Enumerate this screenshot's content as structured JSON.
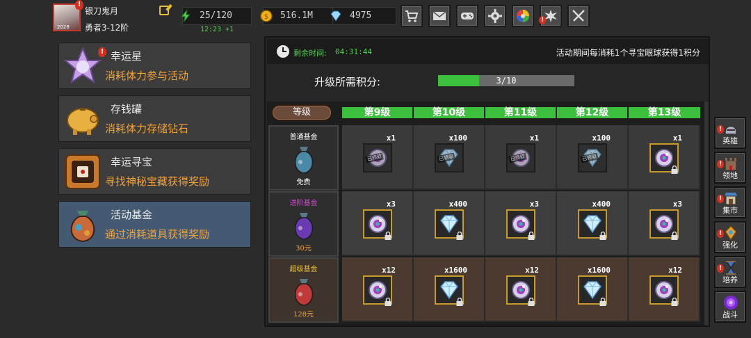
{
  "player": {
    "name": "银刀鬼月",
    "rank": "勇者3-12阶",
    "avatar_year": "2028"
  },
  "resources": {
    "stamina": "25/120",
    "stamina_timer": "12:23 +1",
    "gold": "516.1M",
    "diamonds": "4975"
  },
  "toolbar": [
    {
      "name": "shop-cart-icon",
      "alert": false
    },
    {
      "name": "mail-icon",
      "alert": false
    },
    {
      "name": "gamepad-icon",
      "alert": false
    },
    {
      "name": "settings-gear-icon",
      "alert": false
    },
    {
      "name": "color-wheel-icon",
      "alert": false
    },
    {
      "name": "burst-icon",
      "alert": true
    },
    {
      "name": "crossed-swords-icon",
      "alert": false
    }
  ],
  "events": [
    {
      "title": "幸运星",
      "desc": "消耗体力参与活动",
      "icon": "lucky-star-icon",
      "alert": true
    },
    {
      "title": "存钱罐",
      "desc": "消耗体力存储钻石",
      "icon": "piggy-bank-icon",
      "alert": false
    },
    {
      "title": "幸运寻宝",
      "desc": "寻找神秘宝藏获得奖励",
      "icon": "treasure-chest-icon",
      "alert": false
    },
    {
      "title": "活动基金",
      "desc": "通过消耗道具获得奖励",
      "icon": "fund-bag-icon",
      "alert": false
    }
  ],
  "panel": {
    "remaining_label": "剩余时间:",
    "remaining_time": "04:31:44",
    "rule": "活动期间每消耗1个寻宝眼球获得1积分",
    "upgrade_label": "升级所需积分:",
    "progress_text": "3/10",
    "progress_fraction": 0.3,
    "level_button": "等级",
    "levels": [
      "第9级",
      "第10级",
      "第11级",
      "第12级",
      "第13级"
    ],
    "funds": [
      {
        "name": "普通基金",
        "price": "免费",
        "name_color": "#ffffff",
        "price_color": "#ffffff",
        "bag_color": "#4a8aa8"
      },
      {
        "name": "进阶基金",
        "price": "30元",
        "name_color": "#e040e0",
        "price_color": "#f0a23a",
        "bag_color": "#6a3ab0"
      },
      {
        "name": "超级基金",
        "price": "128元",
        "name_color": "#f0c020",
        "price_color": "#f0a23a",
        "bag_color": "#c03a3a"
      }
    ],
    "rewards": [
      [
        {
          "item": "orb",
          "count": "x1",
          "claimed": true,
          "locked": false
        },
        {
          "item": "diamond",
          "count": "x100",
          "claimed": true,
          "locked": false
        },
        {
          "item": "orb",
          "count": "x1",
          "claimed": true,
          "locked": false
        },
        {
          "item": "diamond",
          "count": "x100",
          "claimed": true,
          "locked": false
        },
        {
          "item": "orb",
          "count": "x1",
          "claimed": false,
          "locked": true
        }
      ],
      [
        {
          "item": "orb",
          "count": "x3",
          "claimed": false,
          "locked": true
        },
        {
          "item": "diamond",
          "count": "x400",
          "claimed": false,
          "locked": true
        },
        {
          "item": "orb",
          "count": "x3",
          "claimed": false,
          "locked": true
        },
        {
          "item": "diamond",
          "count": "x400",
          "claimed": false,
          "locked": true
        },
        {
          "item": "orb",
          "count": "x3",
          "claimed": false,
          "locked": true
        }
      ],
      [
        {
          "item": "orb",
          "count": "x12",
          "claimed": false,
          "locked": true
        },
        {
          "item": "diamond",
          "count": "x1600",
          "claimed": false,
          "locked": true
        },
        {
          "item": "orb",
          "count": "x12",
          "claimed": false,
          "locked": true
        },
        {
          "item": "diamond",
          "count": "x1600",
          "claimed": false,
          "locked": true
        },
        {
          "item": "orb",
          "count": "x12",
          "claimed": false,
          "locked": true
        }
      ]
    ],
    "claimed_label": "已领取"
  },
  "sidebar": [
    {
      "label": "英雄",
      "icon": "helmet-icon",
      "alert": true
    },
    {
      "label": "领地",
      "icon": "castle-icon",
      "alert": true
    },
    {
      "label": "集市",
      "icon": "market-stall-icon",
      "alert": true
    },
    {
      "label": "强化",
      "icon": "upgrade-gem-icon",
      "alert": true
    },
    {
      "label": "培养",
      "icon": "hourglass-icon",
      "alert": true
    },
    {
      "label": "战斗",
      "icon": "portal-icon",
      "alert": false
    }
  ],
  "colors": {
    "accent_green": "#3cbf3c",
    "desc_orange": "#f0a23a",
    "frame_gold": "#c89a2a",
    "alert_red": "#d8301e"
  }
}
